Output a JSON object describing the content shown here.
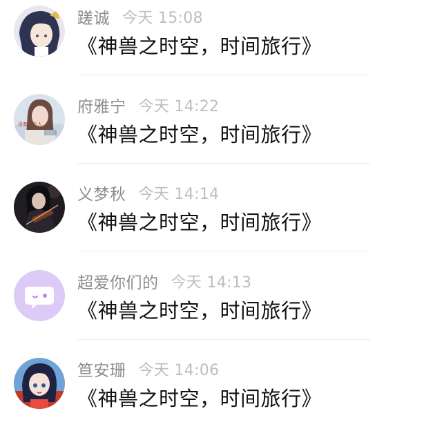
{
  "comments": [
    {
      "user": "蹉诚",
      "time": "今天 15:08",
      "text": "《神兽之时空，时间旅行》",
      "avatar": "anime-girl-avatar"
    },
    {
      "user": "府雅宁",
      "time": "今天 14:22",
      "text": "《神兽之时空，时间旅行》",
      "avatar": "photo-girl-avatar",
      "avatar_texts": [
        "没有一个人",
        "懂我"
      ]
    },
    {
      "user": "义梦秋",
      "time": "今天 14:14",
      "text": "《神兽之时空，时间旅行》",
      "avatar": "violin-player-avatar"
    },
    {
      "user": "超爱你们的",
      "time": "今天 14:13",
      "text": "《神兽之时空，时间旅行》",
      "avatar": "default-chat-bubble-avatar"
    },
    {
      "user": "笪安珊",
      "time": "今天 14:06",
      "text": "《神兽之时空，时间旅行》",
      "avatar": "anime-girl-red-avatar"
    }
  ],
  "colors": {
    "username": "#8c8c8c",
    "timestamp": "#bdbdbd",
    "message": "#111111",
    "divider": "#ededed",
    "default_avatar_bg": "#dccaf7"
  }
}
